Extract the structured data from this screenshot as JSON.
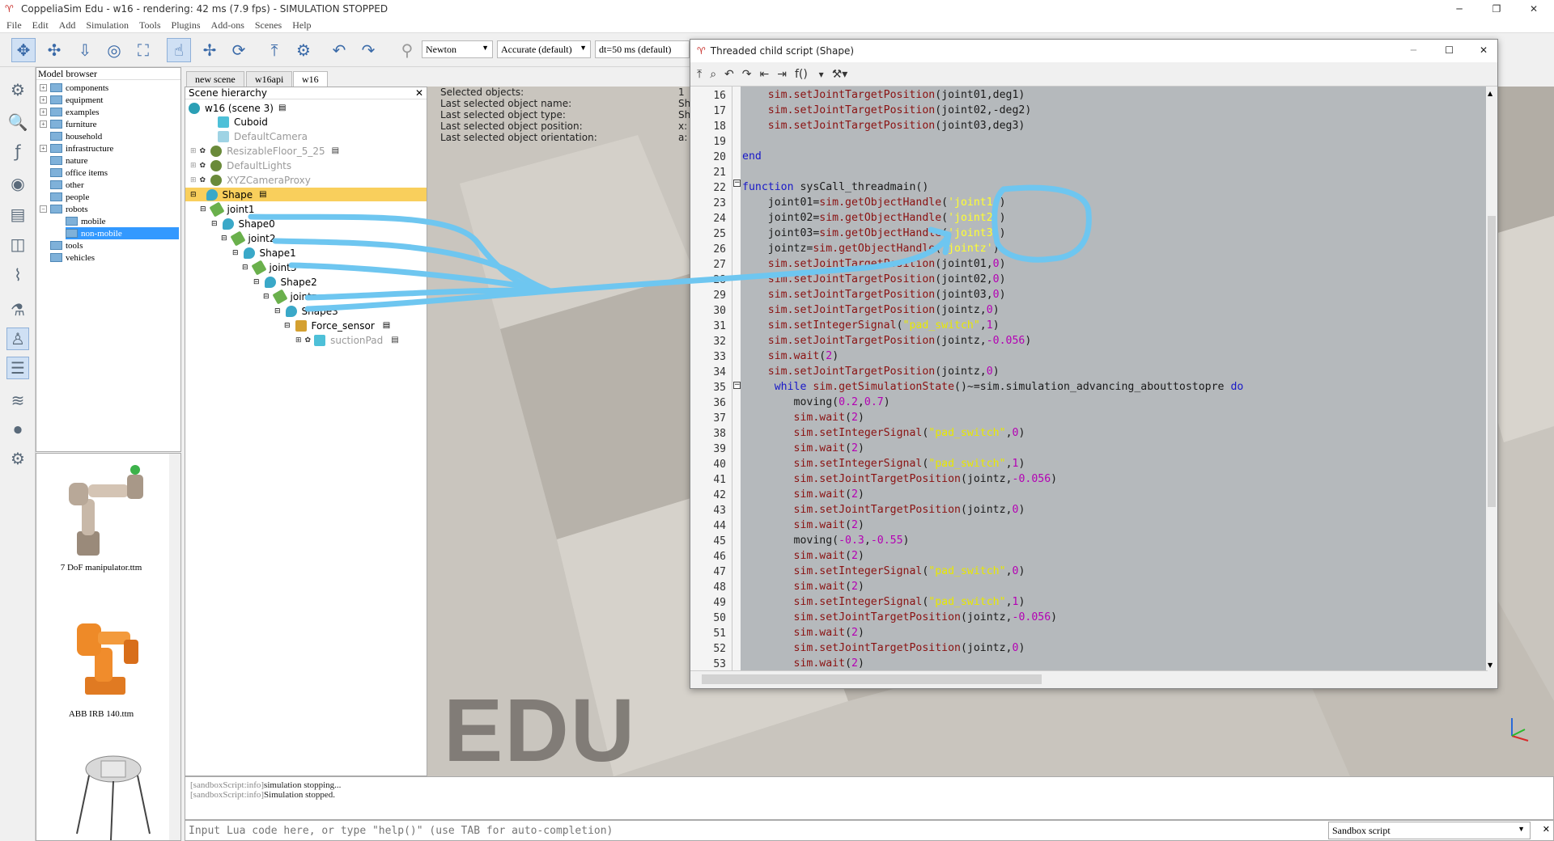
{
  "window": {
    "title": "CoppeliaSim Edu - w16 - rendering: 42 ms (7.9 fps) - SIMULATION STOPPED"
  },
  "menu": [
    "File",
    "Edit",
    "Add",
    "Simulation",
    "Tools",
    "Plugins",
    "Add-ons",
    "Scenes",
    "Help"
  ],
  "toolbar": {
    "engine": "Newton",
    "accuracy": "Accurate (default)",
    "dt": "dt=50 ms (default)"
  },
  "model_browser": {
    "header": "Model browser",
    "items": [
      "components",
      "equipment",
      "examples",
      "furniture",
      "household",
      "infrastructure",
      "nature",
      "office items",
      "other",
      "people",
      "robots",
      "mobile",
      "non-mobile",
      "tools",
      "vehicles"
    ],
    "thumbs": [
      "7 DoF manipulator.ttm",
      "ABB IRB 140.ttm"
    ]
  },
  "scene_tabs": [
    "new scene",
    "w16api",
    "w16"
  ],
  "hierarchy": {
    "header": "Scene hierarchy",
    "rows": [
      "w16 (scene 3)",
      "Cuboid",
      "DefaultCamera",
      "ResizableFloor_5_25",
      "DefaultLights",
      "XYZCameraProxy",
      "Shape",
      "joint1",
      "Shape0",
      "joint2",
      "Shape1",
      "joint3",
      "Shape2",
      "jointz",
      "Shape3",
      "Force_sensor",
      "suctionPad"
    ]
  },
  "info": {
    "lines": [
      "Selected objects:",
      "Last selected object name:",
      "Last selected object type:",
      "Last selected object position:",
      "Last selected object orientation:"
    ],
    "values": [
      "1",
      "Sh",
      "Sh",
      "x:",
      "a:"
    ]
  },
  "watermark": "EDU",
  "console": {
    "lines": [
      {
        "tag": "[sandboxScript:info]",
        "msg": "simulation stopping..."
      },
      {
        "tag": "[sandboxScript:info]",
        "msg": "Simulation stopped."
      }
    ],
    "placeholder": "Input Lua code here, or type \"help()\" (use TAB for auto-completion)",
    "mode": "Sandbox script"
  },
  "editor": {
    "title": "Threaded child script (Shape)",
    "toolbar_fn": "f()",
    "lines": [
      {
        "n": "16",
        "t": "    sim.setJointTargetPosition(joint01,deg1)"
      },
      {
        "n": "17",
        "t": "    sim.setJointTargetPosition(joint02,-deg2)"
      },
      {
        "n": "18",
        "t": "    sim.setJointTargetPosition(joint03,deg3)"
      },
      {
        "n": "19",
        "t": ""
      },
      {
        "n": "20",
        "t": "end"
      },
      {
        "n": "21",
        "t": ""
      },
      {
        "n": "22",
        "t": "function sysCall_threadmain()"
      },
      {
        "n": "23",
        "t": "    joint01=sim.getObjectHandle('joint1')"
      },
      {
        "n": "24",
        "t": "    joint02=sim.getObjectHandle('joint2')"
      },
      {
        "n": "25",
        "t": "    joint03=sim.getObjectHandle('joint3')"
      },
      {
        "n": "26",
        "t": "    jointz=sim.getObjectHandle('jointz')"
      },
      {
        "n": "27",
        "t": "    sim.setJointTargetPosition(joint01,0)"
      },
      {
        "n": "28",
        "t": "    sim.setJointTargetPosition(joint02,0)"
      },
      {
        "n": "29",
        "t": "    sim.setJointTargetPosition(joint03,0)"
      },
      {
        "n": "30",
        "t": "    sim.setJointTargetPosition(jointz,0)"
      },
      {
        "n": "31",
        "t": "    sim.setIntegerSignal(\"pad_switch\",1)"
      },
      {
        "n": "32",
        "t": "    sim.setJointTargetPosition(jointz,-0.056)"
      },
      {
        "n": "33",
        "t": "    sim.wait(2)"
      },
      {
        "n": "34",
        "t": "    sim.setJointTargetPosition(jointz,0)"
      },
      {
        "n": "35",
        "t": "     while sim.getSimulationState()~=sim.simulation_advancing_abouttostopre do"
      },
      {
        "n": "36",
        "t": "        moving(0.2,0.7)"
      },
      {
        "n": "37",
        "t": "        sim.wait(2)"
      },
      {
        "n": "38",
        "t": "        sim.setIntegerSignal(\"pad_switch\",0)"
      },
      {
        "n": "39",
        "t": "        sim.wait(2)"
      },
      {
        "n": "40",
        "t": "        sim.setIntegerSignal(\"pad_switch\",1)"
      },
      {
        "n": "41",
        "t": "        sim.setJointTargetPosition(jointz,-0.056)"
      },
      {
        "n": "42",
        "t": "        sim.wait(2)"
      },
      {
        "n": "43",
        "t": "        sim.setJointTargetPosition(jointz,0)"
      },
      {
        "n": "44",
        "t": "        sim.wait(2)"
      },
      {
        "n": "45",
        "t": "        moving(-0.3,-0.55)"
      },
      {
        "n": "46",
        "t": "        sim.wait(2)"
      },
      {
        "n": "47",
        "t": "        sim.setIntegerSignal(\"pad_switch\",0)"
      },
      {
        "n": "48",
        "t": "        sim.wait(2)"
      },
      {
        "n": "49",
        "t": "        sim.setIntegerSignal(\"pad_switch\",1)"
      },
      {
        "n": "50",
        "t": "        sim.setJointTargetPosition(jointz,-0.056)"
      },
      {
        "n": "51",
        "t": "        sim.wait(2)"
      },
      {
        "n": "52",
        "t": "        sim.setJointTargetPosition(jointz,0)"
      },
      {
        "n": "53",
        "t": "        sim.wait(2)"
      }
    ]
  },
  "colors": {
    "selection": "#f9cf5c",
    "code_bg": "#b5b9bc",
    "annotation": "#6ec6f0",
    "keyword": "#1818c8",
    "number": "#b400b4",
    "string": "#e8e800"
  }
}
